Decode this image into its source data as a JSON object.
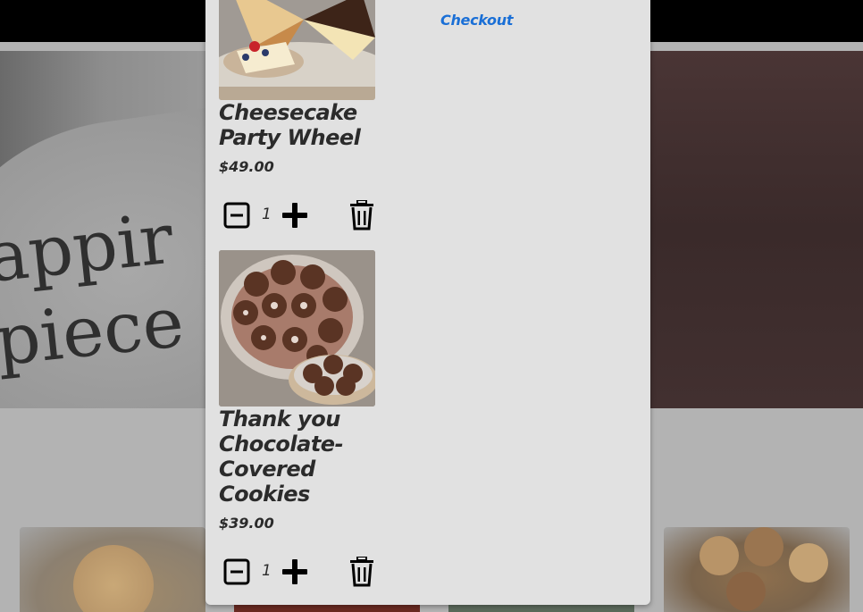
{
  "cart": {
    "checkout_label": "Checkout",
    "items": [
      {
        "name": "Cheesecake Party Wheel",
        "price": "$49.00",
        "quantity": "1",
        "image_icon": "cheesecake-image"
      },
      {
        "name": "Thank you Chocolate-Covered Cookies",
        "price": "$39.00",
        "quantity": "1",
        "image_icon": "chocolate-cookies-image"
      }
    ]
  },
  "colors": {
    "checkout_link": "#1a6fd6",
    "cart_background": "#e1e1e1",
    "nav_background": "#000000"
  },
  "background_page": {
    "hero_image_icon": "cake-hero-image"
  }
}
